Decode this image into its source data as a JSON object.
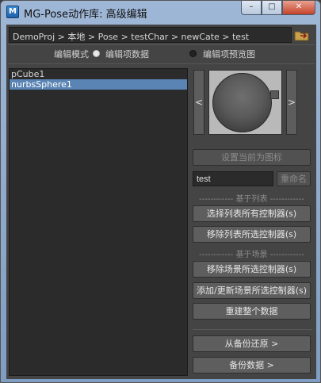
{
  "window": {
    "title": "MG-Pose动作库: 高级编辑",
    "icon_glyph": "M",
    "minimize_glyph": "–",
    "maximize_glyph": "□",
    "close_glyph": "✕"
  },
  "path": {
    "text": "DemoProj > 本地 > Pose > testChar > newCate > test",
    "icon": "folder-link-icon"
  },
  "mode": {
    "label": "编辑模式",
    "options": [
      "编辑项数据",
      "编辑项预览图"
    ],
    "selected_index": 0
  },
  "list": {
    "items": [
      "pCube1",
      "nurbsSphere1"
    ],
    "selected_index": 1
  },
  "preview": {
    "prev_label": "<",
    "next_label": ">"
  },
  "buttons": {
    "set_icon": "设置当前为图标",
    "rename_value": "test",
    "rename": "重命名",
    "list_section": "------------ 基于列表 ------------",
    "select_list_controls": "选择列表所有控制器(s)",
    "remove_list_controls": "移除列表所选控制器(s)",
    "scene_section": "------------ 基于场景 ------------",
    "remove_scene_controls": "移除场景所选控制器(s)",
    "add_update_scene_controls": "添加/更新场景所选控制器(s)",
    "rebuild_data": "重建整个数据",
    "restore_backup": "从备份还原 >",
    "backup_data": "备份数据 >"
  }
}
